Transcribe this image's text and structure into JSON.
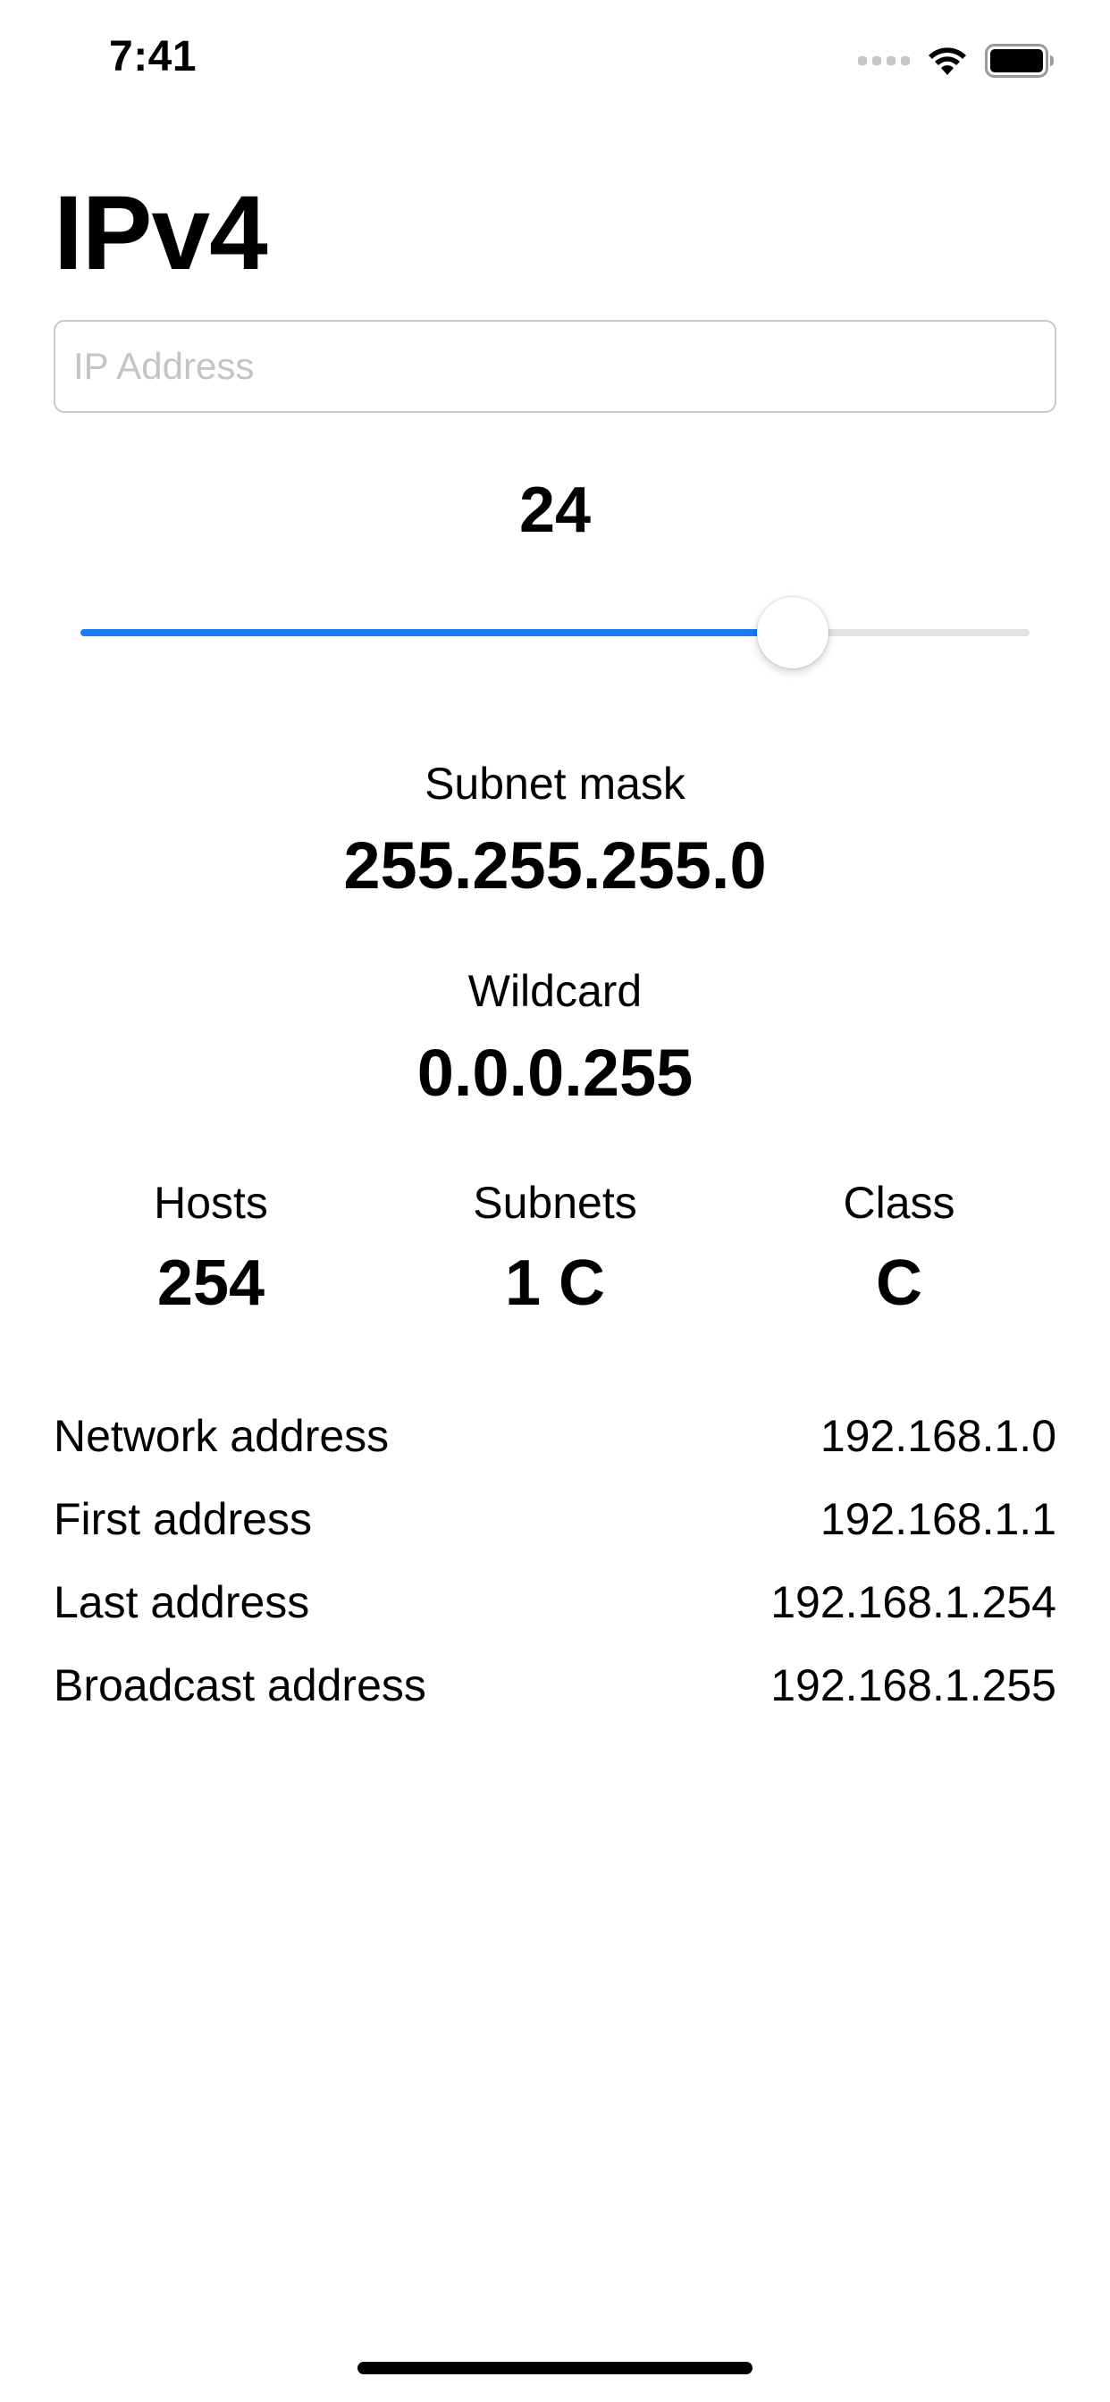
{
  "status_bar": {
    "time": "7:41",
    "icons": [
      "signal-icon",
      "wifi-icon",
      "battery-icon"
    ]
  },
  "title": "IPv4",
  "ip_input": {
    "value": "",
    "placeholder": "IP Address"
  },
  "prefix": {
    "value": "24",
    "slider_min": 0,
    "slider_max": 32,
    "slider_value": 24
  },
  "subnet_mask": {
    "label": "Subnet mask",
    "value": "255.255.255.0"
  },
  "wildcard": {
    "label": "Wildcard",
    "value": "0.0.0.255"
  },
  "stats": {
    "hosts": {
      "label": "Hosts",
      "value": "254"
    },
    "subnets": {
      "label": "Subnets",
      "value": "1 C"
    },
    "class": {
      "label": "Class",
      "value": "C"
    }
  },
  "addresses": [
    {
      "label": "Network address",
      "value": "192.168.1.0"
    },
    {
      "label": "First address",
      "value": "192.168.1.1"
    },
    {
      "label": "Last address",
      "value": "192.168.1.254"
    },
    {
      "label": "Broadcast address",
      "value": "192.168.1.255"
    }
  ],
  "colors": {
    "accent": "#1a7cf5",
    "track": "#e3e3e6",
    "placeholder": "#c4c4c7",
    "input_border": "#c9c9cc"
  }
}
